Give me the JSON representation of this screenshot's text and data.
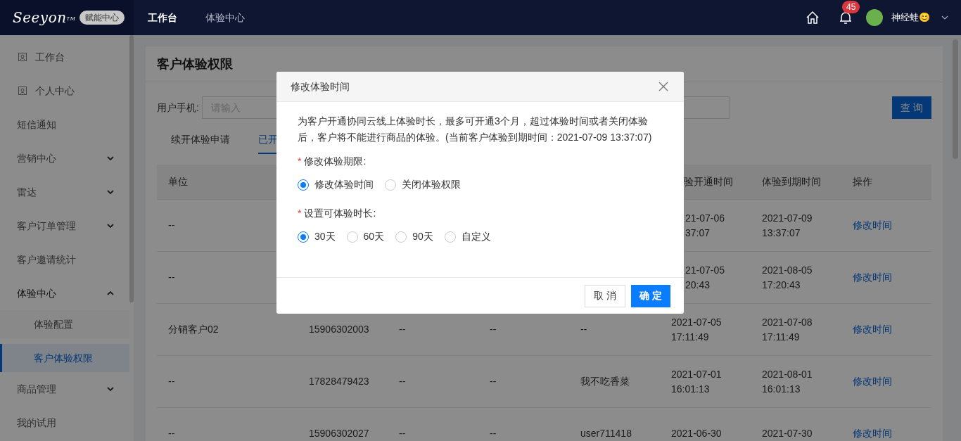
{
  "top_bar": {
    "logo": {
      "text": "Seeyon",
      "mark": "TM",
      "badge": "赋能中心"
    },
    "nav": [
      {
        "label": "工作台",
        "selected": true
      },
      {
        "label": "体验中心",
        "selected": false
      }
    ],
    "notifications": "45",
    "user": "神经蛙😊"
  },
  "sidebar": {
    "items": [
      {
        "label": "工作台",
        "kind": "icon"
      },
      {
        "label": "个人中心",
        "kind": "icon"
      },
      {
        "label": "短信通知",
        "kind": "plain"
      },
      {
        "label": "营销中心",
        "kind": "group",
        "expanded": false
      },
      {
        "label": "雷达",
        "kind": "group",
        "expanded": false
      },
      {
        "label": "客户订单管理",
        "kind": "group",
        "expanded": false
      },
      {
        "label": "客户邀请统计",
        "kind": "plain"
      },
      {
        "label": "体验中心",
        "kind": "group",
        "expanded": true,
        "children": [
          {
            "label": "体验配置",
            "selected": false
          },
          {
            "label": "客户体验权限",
            "selected": true
          }
        ]
      },
      {
        "label": "商品管理",
        "kind": "group",
        "expanded": false
      },
      {
        "label": "我的试用",
        "kind": "plain"
      }
    ]
  },
  "page": {
    "title": "客户体验权限",
    "filter_label": "用户手机:",
    "filter_placeholder": "请输入",
    "query_button": "查 询",
    "tabs": [
      {
        "label": "续开体验申请",
        "selected": false
      },
      {
        "label": "已开",
        "selected": true
      }
    ],
    "table": {
      "columns": [
        {
          "text": "单位"
        },
        null,
        null,
        null,
        null,
        {
          "text": "验开通时间",
          "cut": true
        },
        {
          "text": "体验到期时间"
        },
        {
          "text": "操作"
        }
      ],
      "rows": [
        {
          "cells": [
            [
              "--"
            ],
            null,
            null,
            null,
            null,
            [
              "21-07-06",
              "37:07"
            ],
            [
              "2021-07-09",
              "13:37:07"
            ]
          ],
          "cut": true,
          "action": "修改时间"
        },
        {
          "cells": [
            [
              "--"
            ],
            null,
            null,
            null,
            null,
            [
              "21-07-05",
              "20:43"
            ],
            [
              "2021-08-05",
              "17:20:43"
            ]
          ],
          "cut": true,
          "action": "修改时间"
        },
        {
          "cells": [
            [
              "分销客户02"
            ],
            [
              "15906302003"
            ],
            [
              "--"
            ],
            [
              "--"
            ],
            [
              "--"
            ],
            [
              "2021-07-05",
              "17:11:49"
            ],
            [
              "2021-07-08",
              "17:11:49"
            ]
          ],
          "cut": false,
          "action": "修改时间"
        },
        {
          "cells": [
            [
              "--"
            ],
            [
              "17828479423"
            ],
            [
              "--"
            ],
            [
              "--"
            ],
            [
              "我不吃香菜"
            ],
            [
              "2021-07-01",
              "16:01:13"
            ],
            [
              "2021-08-01",
              "16:01:13"
            ]
          ],
          "cut": false,
          "action": "修改时间"
        },
        {
          "cells": [
            [
              "--"
            ],
            [
              "15906302027"
            ],
            [
              "--"
            ],
            [
              "--"
            ],
            [
              "user711418"
            ],
            [
              "2021-06-30"
            ],
            [
              "2021-07-30"
            ]
          ],
          "cut": false,
          "action": "修改时间"
        }
      ]
    }
  },
  "dialog": {
    "title": "修改体验时间",
    "description": "为客户开通协同云线上体验时长，最多可开通3个月，超过体验时间或者关闭体验后，客户将不能进行商品的体验。(当前客户体验到期时间：2021-07-09 13:37:07)",
    "fields": [
      {
        "label": "修改体验期限:",
        "required_mark": "*",
        "options": [
          {
            "label": "修改体验时间",
            "selected": true
          },
          {
            "label": "关闭体验权限",
            "selected": false
          }
        ]
      },
      {
        "label": "设置可体验时长:",
        "required_mark": "*",
        "options": [
          {
            "label": "30天",
            "selected": true
          },
          {
            "label": "60天",
            "selected": false
          },
          {
            "label": "90天",
            "selected": false
          },
          {
            "label": "自定义",
            "selected": false
          }
        ]
      }
    ],
    "buttons": [
      {
        "label": "取 消",
        "kind": "secondary"
      },
      {
        "label": "确 定",
        "kind": "primary"
      }
    ]
  }
}
